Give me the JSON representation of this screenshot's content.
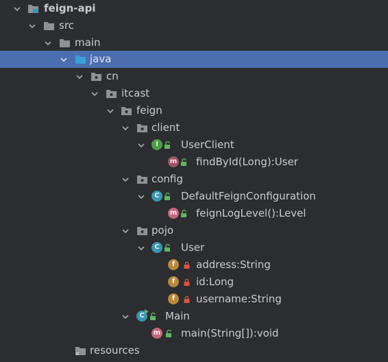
{
  "project_tree": {
    "root": {
      "label": "feign-api",
      "expanded": true
    },
    "src": {
      "label": "src",
      "expanded": true
    },
    "main": {
      "label": "main",
      "expanded": true
    },
    "java": {
      "label": "java",
      "expanded": true,
      "selected": true
    },
    "cn": {
      "label": "cn",
      "expanded": true
    },
    "itcast": {
      "label": "itcast",
      "expanded": true
    },
    "feign": {
      "label": "feign",
      "expanded": true
    },
    "client": {
      "label": "client",
      "expanded": true
    },
    "user_client": {
      "label": "UserClient",
      "kind_badge": "I",
      "expanded": true
    },
    "find_by_id": {
      "label": "findById(Long):User",
      "kind_badge": "m"
    },
    "config": {
      "label": "config",
      "expanded": true
    },
    "default_config": {
      "label": "DefaultFeignConfiguration",
      "kind_badge": "C",
      "expanded": true
    },
    "feign_log_level": {
      "label": "feignLogLevel():Level",
      "kind_badge": "m"
    },
    "pojo": {
      "label": "pojo",
      "expanded": true
    },
    "user": {
      "label": "User",
      "kind_badge": "C",
      "expanded": true
    },
    "address": {
      "label": "address:String",
      "kind_badge": "f"
    },
    "id": {
      "label": "id:Long",
      "kind_badge": "f"
    },
    "username": {
      "label": "username:String",
      "kind_badge": "f"
    },
    "main_class": {
      "label": "Main",
      "kind_badge": "C",
      "expanded": true
    },
    "main_method": {
      "label": "main(String[]):void",
      "kind_badge": "m"
    },
    "resources": {
      "label": "resources"
    }
  },
  "colors": {
    "background": "#2b2d30",
    "selection": "#4b6eaf",
    "text": "#c9ccd1",
    "folder": "#8e9196",
    "source_folder": "#3592c4",
    "interface_badge": "#4d9c46",
    "class_badge": "#3a95b0",
    "method_badge": "#c4677c",
    "field_badge": "#b8893c",
    "public_mark": "#5fb760",
    "private_mark": "#d9553f"
  }
}
